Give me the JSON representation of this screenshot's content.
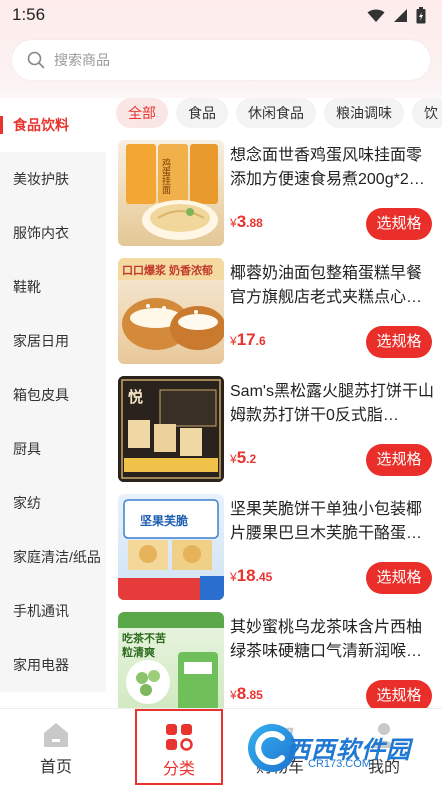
{
  "status_bar": {
    "time": "1:56"
  },
  "search": {
    "placeholder": "搜索商品"
  },
  "sidebar": {
    "items": [
      {
        "label": "食品饮料",
        "active": true
      },
      {
        "label": "美妆护肤",
        "active": false
      },
      {
        "label": "服饰内衣",
        "active": false
      },
      {
        "label": "鞋靴",
        "active": false
      },
      {
        "label": "家居日用",
        "active": false
      },
      {
        "label": "箱包皮具",
        "active": false
      },
      {
        "label": "厨具",
        "active": false
      },
      {
        "label": "家纺",
        "active": false
      },
      {
        "label": "家庭清洁/纸品",
        "active": false
      },
      {
        "label": "手机通讯",
        "active": false
      },
      {
        "label": "家用电器",
        "active": false
      }
    ]
  },
  "chips": [
    {
      "label": "全部",
      "active": true
    },
    {
      "label": "食品",
      "active": false
    },
    {
      "label": "休闲食品",
      "active": false
    },
    {
      "label": "粮油调味",
      "active": false
    },
    {
      "label": "饮",
      "active": false
    }
  ],
  "products": [
    {
      "title": "想念面世香鸡蛋风味挂面零添加方便速食易煮200g*2…",
      "price_yen": "¥",
      "price_int": "3",
      "price_dec": ".88",
      "button": "选规格",
      "thumb_text": "鸡蛋挂面"
    },
    {
      "title": "椰蓉奶油面包整箱蛋糕早餐官方旗舰店老式夹糕点心…",
      "price_yen": "¥",
      "price_int": "17",
      "price_dec": ".6",
      "button": "选规格",
      "thumb_text": "口口爆浆 奶香浓郁"
    },
    {
      "title": "Sam's黑松露火腿苏打饼干山姆款苏打饼干0反式脂…",
      "price_yen": "¥",
      "price_int": "5",
      "price_dec": ".2",
      "button": "选规格",
      "thumb_text": "悦"
    },
    {
      "title": "坚果芙脆饼干单独小包装椰片腰果巴旦木芙脆干酪蛋…",
      "price_yen": "¥",
      "price_int": "18",
      "price_dec": ".45",
      "button": "选规格",
      "thumb_text": "坚果芙脆"
    },
    {
      "title": "其妙蜜桃乌龙茶味含片西柚绿茶味硬糖口气清新润喉…",
      "price_yen": "¥",
      "price_int": "8",
      "price_dec": ".85",
      "button": "选规格",
      "thumb_text": "吃茶不苦 粒清爽"
    }
  ],
  "tabbar": {
    "tabs": [
      {
        "label": "首页",
        "icon": "home-icon",
        "active": false
      },
      {
        "label": "分类",
        "icon": "category-icon",
        "active": true
      },
      {
        "label": "购物车",
        "icon": "cart-icon",
        "active": false
      },
      {
        "label": "我的",
        "icon": "profile-icon",
        "active": false
      }
    ]
  },
  "watermark": {
    "text": "西西软件园",
    "sub": "CR173.COM"
  },
  "colors": {
    "accent": "#e8332e",
    "button": "#ea2f2a",
    "sidebar_bg": "#f6f6f6",
    "chip_bg": "#f3f3f3"
  }
}
